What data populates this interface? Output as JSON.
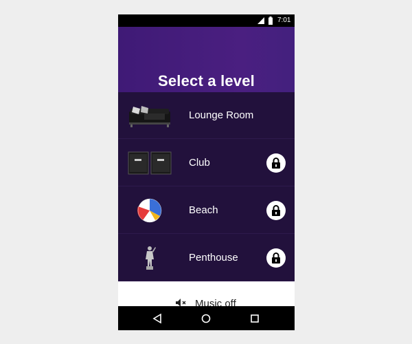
{
  "status_bar": {
    "time": "7:01",
    "icons": [
      "signal-icon",
      "battery-icon"
    ]
  },
  "header": {
    "title": "Select a level"
  },
  "levels": [
    {
      "label": "Lounge Room",
      "thumbnail": "couch-icon",
      "locked": false
    },
    {
      "label": "Club",
      "thumbnail": "speakers-icon",
      "locked": true
    },
    {
      "label": "Beach",
      "thumbnail": "beach-ball-icon",
      "locked": true
    },
    {
      "label": "Penthouse",
      "thumbnail": "statue-icon",
      "locked": true
    }
  ],
  "music": {
    "label": "Music off",
    "icon": "speaker-muted-icon"
  },
  "nav_bar": {
    "buttons": [
      "back-icon",
      "home-icon",
      "recents-icon"
    ]
  },
  "colors": {
    "header_bg": "#43207e",
    "list_bg": "#22113c",
    "divider": "#2e1a4d",
    "page_bg": "#eeeeee"
  }
}
